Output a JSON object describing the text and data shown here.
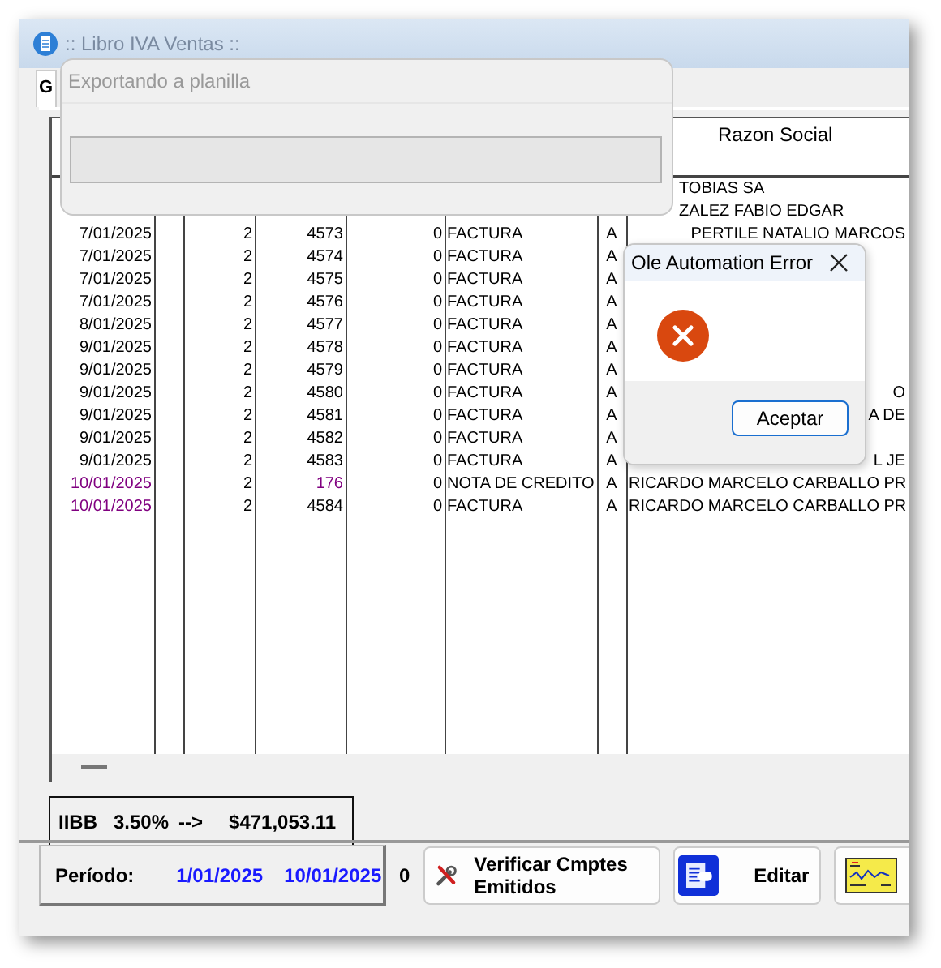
{
  "window": {
    "title": ":: Libro IVA Ventas ::"
  },
  "tabs": [
    {
      "label": "G",
      "selected": true
    }
  ],
  "grid": {
    "razon_header": "Razon Social",
    "rows": [
      {
        "razon": "TOBIAS SA"
      },
      {
        "razon": "ZALEZ FABIO EDGAR"
      },
      {
        "kind": "factura",
        "fecha": "7/01/2025",
        "serie": "2",
        "numero": "4573",
        "importe": "0",
        "tipo": "FACTURA",
        "letra": "A",
        "razon": "PERTILE NATALIO MARCOS"
      },
      {
        "kind": "factura",
        "fecha": "7/01/2025",
        "serie": "2",
        "numero": "4574",
        "importe": "0",
        "tipo": "FACTURA",
        "letra": "A"
      },
      {
        "kind": "factura",
        "fecha": "7/01/2025",
        "serie": "2",
        "numero": "4575",
        "importe": "0",
        "tipo": "FACTURA",
        "letra": "A"
      },
      {
        "kind": "factura",
        "fecha": "7/01/2025",
        "serie": "2",
        "numero": "4576",
        "importe": "0",
        "tipo": "FACTURA",
        "letra": "A"
      },
      {
        "kind": "factura",
        "fecha": "8/01/2025",
        "serie": "2",
        "numero": "4577",
        "importe": "0",
        "tipo": "FACTURA",
        "letra": "A"
      },
      {
        "kind": "factura",
        "fecha": "9/01/2025",
        "serie": "2",
        "numero": "4578",
        "importe": "0",
        "tipo": "FACTURA",
        "letra": "A"
      },
      {
        "kind": "factura",
        "fecha": "9/01/2025",
        "serie": "2",
        "numero": "4579",
        "importe": "0",
        "tipo": "FACTURA",
        "letra": "A"
      },
      {
        "kind": "factura",
        "fecha": "9/01/2025",
        "serie": "2",
        "numero": "4580",
        "importe": "0",
        "tipo": "FACTURA",
        "letra": "A",
        "razon": "O"
      },
      {
        "kind": "factura",
        "fecha": "9/01/2025",
        "serie": "2",
        "numero": "4581",
        "importe": "0",
        "tipo": "FACTURA",
        "letra": "A",
        "razon": "A DE"
      },
      {
        "kind": "factura",
        "fecha": "9/01/2025",
        "serie": "2",
        "numero": "4582",
        "importe": "0",
        "tipo": "FACTURA",
        "letra": "A"
      },
      {
        "kind": "factura",
        "fecha": "9/01/2025",
        "serie": "2",
        "numero": "4583",
        "importe": "0",
        "tipo": "FACTURA",
        "letra": "A",
        "razon": "L JE"
      },
      {
        "kind": "nota_credito",
        "color": "#800080",
        "fecha": "10/01/2025",
        "serie": "2",
        "numero": "176",
        "importe": "0",
        "tipo": "NOTA DE CREDITO",
        "letra": "A",
        "razon": "RICARDO MARCELO CARBALLO PR"
      },
      {
        "kind": "factura",
        "color": "#800080",
        "fecha": "10/01/2025",
        "serie": "2",
        "numero": "4584",
        "importe": "0",
        "tipo": "FACTURA",
        "letra": "A",
        "razon": "RICARDO MARCELO CARBALLO PR"
      }
    ]
  },
  "summary": {
    "label": "IIBB",
    "rate": "3.50%",
    "arrow": "-->",
    "amount": "$471,053.11"
  },
  "period": {
    "label": "Período:",
    "from": "1/01/2025",
    "to": "10/01/2025"
  },
  "count": "0",
  "buttons": [
    {
      "kind": "tools",
      "label": "Verificar Cmptes Emitidos"
    },
    {
      "kind": "edit",
      "label": "Editar"
    },
    {
      "kind": "chart"
    }
  ],
  "export_dialog": {
    "title": "Exportando a planilla",
    "level": 0
  },
  "error_dialog": {
    "title": "Ole Automation Error",
    "button": "Aceptar"
  }
}
